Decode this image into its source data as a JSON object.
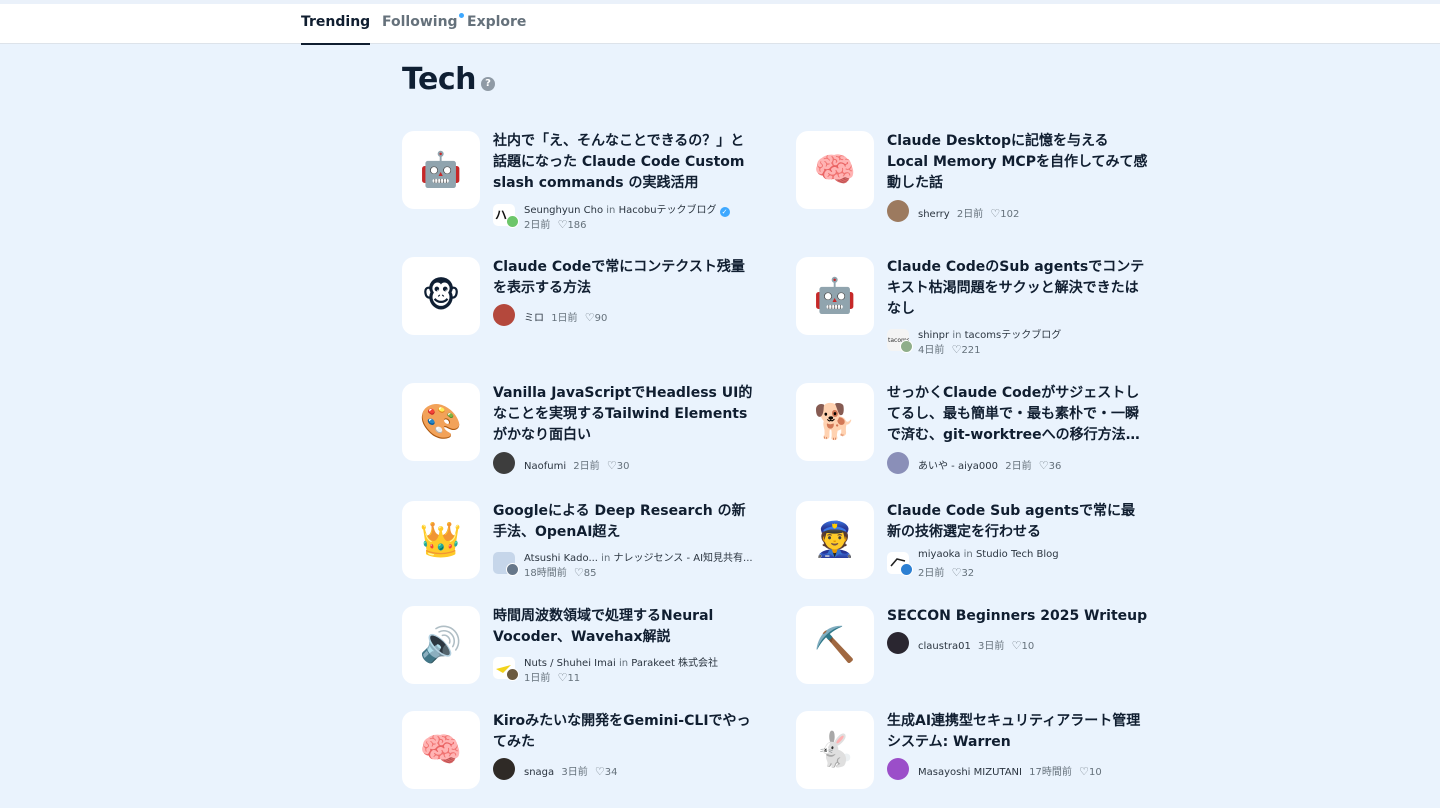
{
  "nav": {
    "tabs": [
      {
        "label": "Trending",
        "active": true
      },
      {
        "label": "Following",
        "active": false,
        "has_dot": true
      },
      {
        "label": "Explore",
        "active": false
      }
    ]
  },
  "section": {
    "title": "Tech",
    "help_icon": "question-circle-icon"
  },
  "articles": [
    {
      "emoji": "🤖",
      "title": "社内で「え、そんなことできるの？」と話題になった Claude Code Custom slash commands の実践活用",
      "author": "Seunghyun Cho",
      "in": "in",
      "publication": "Hacobuテックブログ",
      "verified": true,
      "time": "2日前",
      "likes": "186"
    },
    {
      "emoji": "🧠",
      "title": "Claude Desktopに記憶を与えるLocal Memory MCPを自作してみて感動した話",
      "author": "sherry",
      "time": "2日前",
      "likes": "102"
    },
    {
      "emoji": "🐵",
      "title": "Claude Codeで常にコンテクスト残量を表示する方法",
      "author": "ミロ",
      "time": "1日前",
      "likes": "90"
    },
    {
      "emoji": "🤖",
      "title": "Claude CodeのSub agentsでコンテキスト枯渇問題をサクッと解決できたはなし",
      "author": "shinpr",
      "in": "in",
      "publication": "tacomsテックブログ",
      "time": "4日前",
      "likes": "221"
    },
    {
      "emoji": "🎨",
      "title": "Vanilla JavaScriptでHeadless UI的なことを実現するTailwind Elementsがかなり面白い",
      "author": "Naofumi",
      "time": "2日前",
      "likes": "30"
    },
    {
      "emoji": "🐕",
      "title": "せっかくClaude Codeがサジェストしてるし、最も簡単で・最も素朴で・一瞬で済む、git-worktreeへの移行方法を教えます",
      "author": "あいや - aiya000",
      "time": "2日前",
      "likes": "36"
    },
    {
      "emoji": "👑",
      "title": "Googleによる Deep Research の新手法、OpenAI超え",
      "author": "Atsushi Kado...",
      "in": "in",
      "publication": "ナレッジセンス - AI知見共有...",
      "time": "18時間前",
      "likes": "85"
    },
    {
      "emoji": "👮",
      "title": "Claude Code Sub agentsで常に最新の技術選定を行わせる",
      "author": "miyaoka",
      "in": "in",
      "publication": "Studio Tech Blog",
      "time": "2日前",
      "likes": "32"
    },
    {
      "emoji": "🔊",
      "title": "時間周波数領域で処理するNeural Vocoder、Wavehax解説",
      "author": "Nuts / Shuhei Imai",
      "in": "in",
      "publication": "Parakeet 株式会社",
      "time": "1日前",
      "likes": "11"
    },
    {
      "emoji": "⛏️",
      "title": "SECCON Beginners 2025 Writeup",
      "author": "claustra01",
      "time": "3日前",
      "likes": "10"
    },
    {
      "emoji": "🧠",
      "title": "Kiroみたいな開発をGemini-CLIでやってみた",
      "author": "snaga",
      "time": "3日前",
      "likes": "34"
    },
    {
      "emoji": "🐇",
      "title": "生成AI連携型セキュリティアラート管理システム: Warren",
      "author": "Masayoshi MIZUTANI",
      "time": "17時間前",
      "likes": "10"
    }
  ],
  "colors": {
    "accent": "#3ea8ff",
    "background": "#eaf3fd",
    "text": "#101e30"
  },
  "heart_glyph": "♡"
}
